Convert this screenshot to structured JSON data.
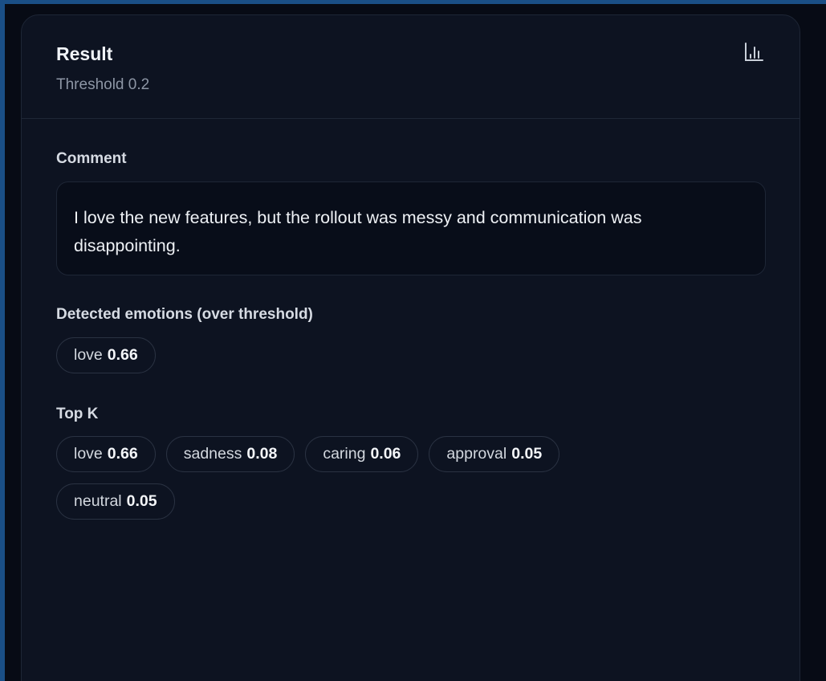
{
  "result": {
    "title": "Result",
    "threshold_text": "Threshold 0.2",
    "chart_button_icon": "bar-chart-icon"
  },
  "comment": {
    "label": "Comment",
    "text": "I love the new features, but the rollout was messy and communication was disappointing."
  },
  "detected": {
    "label": "Detected emotions (over threshold)",
    "chips": [
      {
        "label": "love",
        "score": "0.66"
      }
    ]
  },
  "top_k": {
    "label": "Top K",
    "chips": [
      {
        "label": "love",
        "score": "0.66"
      },
      {
        "label": "sadness",
        "score": "0.08"
      },
      {
        "label": "caring",
        "score": "0.06"
      },
      {
        "label": "approval",
        "score": "0.05"
      },
      {
        "label": "neutral",
        "score": "0.05"
      }
    ]
  },
  "colors": {
    "frame_accent": "#1a4f86",
    "card_background": "#0d1321",
    "text_primary": "#f1f4f8",
    "text_muted": "#8d96a5"
  }
}
